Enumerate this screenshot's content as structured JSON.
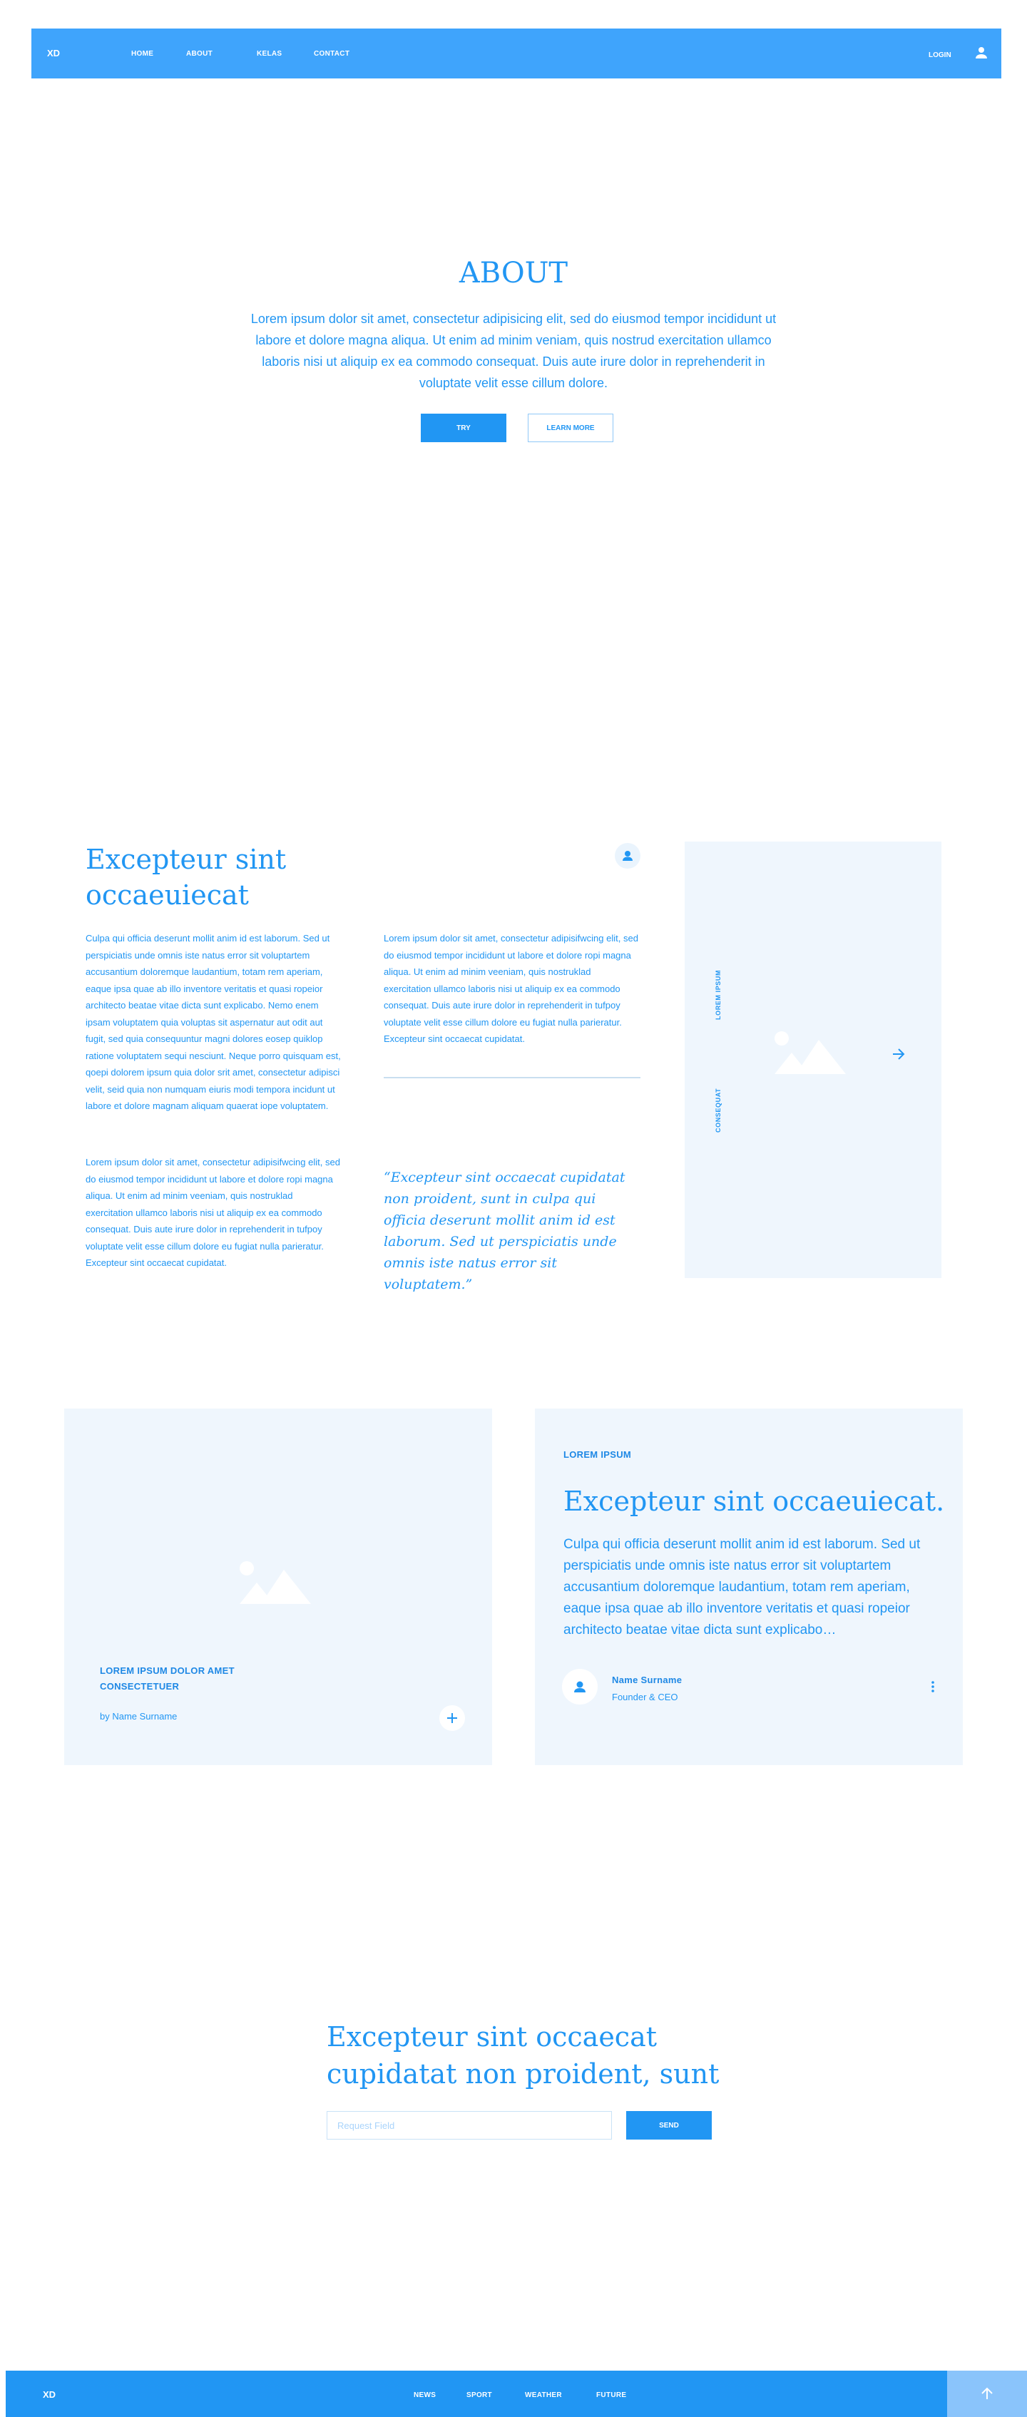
{
  "header": {
    "logo": "XD",
    "nav": [
      "HOME",
      "ABOUT",
      "KELAS",
      "CONTACT"
    ],
    "login": "LOGIN"
  },
  "hero": {
    "title": "ABOUT",
    "text": "Lorem ipsum dolor sit amet, consectetur adipisicing elit, sed do eiusmod tempor incididunt ut labore et dolore magna aliqua. Ut enim ad minim veniam, quis nostrud exercitation ullamco laboris nisi ut aliquip ex ea commodo consequat. Duis aute irure dolor in reprehenderit in voluptate velit esse cillum dolore.",
    "try_label": "TRY",
    "learn_label": "LEARN MORE"
  },
  "feature": {
    "title": "Excepteur sint occaeuiecat",
    "col1_p1": "Culpa qui officia deserunt mollit anim id est laborum. Sed ut perspiciatis unde omnis iste natus error sit voluptartem accusantium doloremque laudantium, totam rem aperiam, eaque ipsa quae ab illo inventore veritatis et quasi ropeior architecto beatae vitae dicta sunt explicabo. Nemo enem ipsam voluptatem quia voluptas sit aspernatur aut odit aut fugit, sed quia consequuntur magni dolores eosep quiklop ratione voluptatem sequi nesciunt. Neque porro quisquam est, qoepi dolorem ipsum quia dolor srit amet, consectetur adipisci velit, seid quia non numquam eiuris modi tempora incidunt ut labore et dolore magnam aliquam quaerat iope voluptatem.",
    "col1_p2": "Lorem ipsum dolor sit amet, consectetur adipisifwcing elit, sed do eiusmod tempor incididunt ut labore et dolore ropi magna aliqua. Ut enim ad minim veeniam, quis nostruklad exercitation ullamco laboris nisi ut aliquip ex ea commodo consequat. Duis aute irure dolor in reprehenderit in tufpoy voluptate velit esse cillum dolore eu fugiat nulla parieratur. Excepteur sint occaecat cupidatat.",
    "col2_p1": "Lorem ipsum dolor sit amet, consectetur adipisifwcing elit, sed do eiusmod tempor incididunt ut labore et dolore ropi magna aliqua. Ut enim ad minim veeniam, quis nostruklad exercitation ullamco laboris nisi ut aliquip ex ea commodo consequat. Duis aute irure dolor in reprehenderit in tufpoy voluptate velit esse cillum dolore eu fugiat nulla parieratur. Excepteur sint occaecat cupidatat.",
    "quote": "“Excepteur sint occaecat cupidatat non proident, sunt in culpa qui officia deserunt mollit anim id est laborum. Sed ut perspiciatis unde omnis iste natus error sit voluptatem.”",
    "side_label_1": "LOREM IPSUM",
    "side_label_2": "CONSEQUAT"
  },
  "card_left": {
    "title_line1": "LOREM IPSUM DOLOR AMET",
    "title_line2": "CONSECTETUER",
    "byline": "by Name Surname"
  },
  "card_right": {
    "tag": "LOREM IPSUM",
    "title": "Excepteur sint occaeuiecat.",
    "text": "Culpa qui officia deserunt mollit anim id est laborum. Sed ut perspiciatis unde omnis iste natus error sit voluptartem accusantium doloremque laudantium, totam rem aperiam, eaque ipsa quae ab illo inventore veritatis et quasi ropeior architecto beatae vitae dicta sunt explicabo…",
    "author_name": "Name Surname",
    "author_role": "Founder & CEO"
  },
  "newsletter": {
    "title": "Excepteur sint occaecat cupidatat non proident, sunt",
    "placeholder": "Request Field",
    "send_label": "SEND"
  },
  "footer": {
    "logo": "XD",
    "nav": [
      "NEWS",
      "SPORT",
      "WEATHER",
      "FUTURE"
    ]
  },
  "colors": {
    "primary": "#2196f3",
    "header": "#3fa4fc",
    "panel": "#eff6fd",
    "to_top": "#8ac4fb"
  },
  "icons": [
    "user-icon",
    "image-placeholder-icon",
    "arrow-right-icon",
    "plus-icon",
    "more-vert-icon",
    "arrow-up-icon"
  ]
}
